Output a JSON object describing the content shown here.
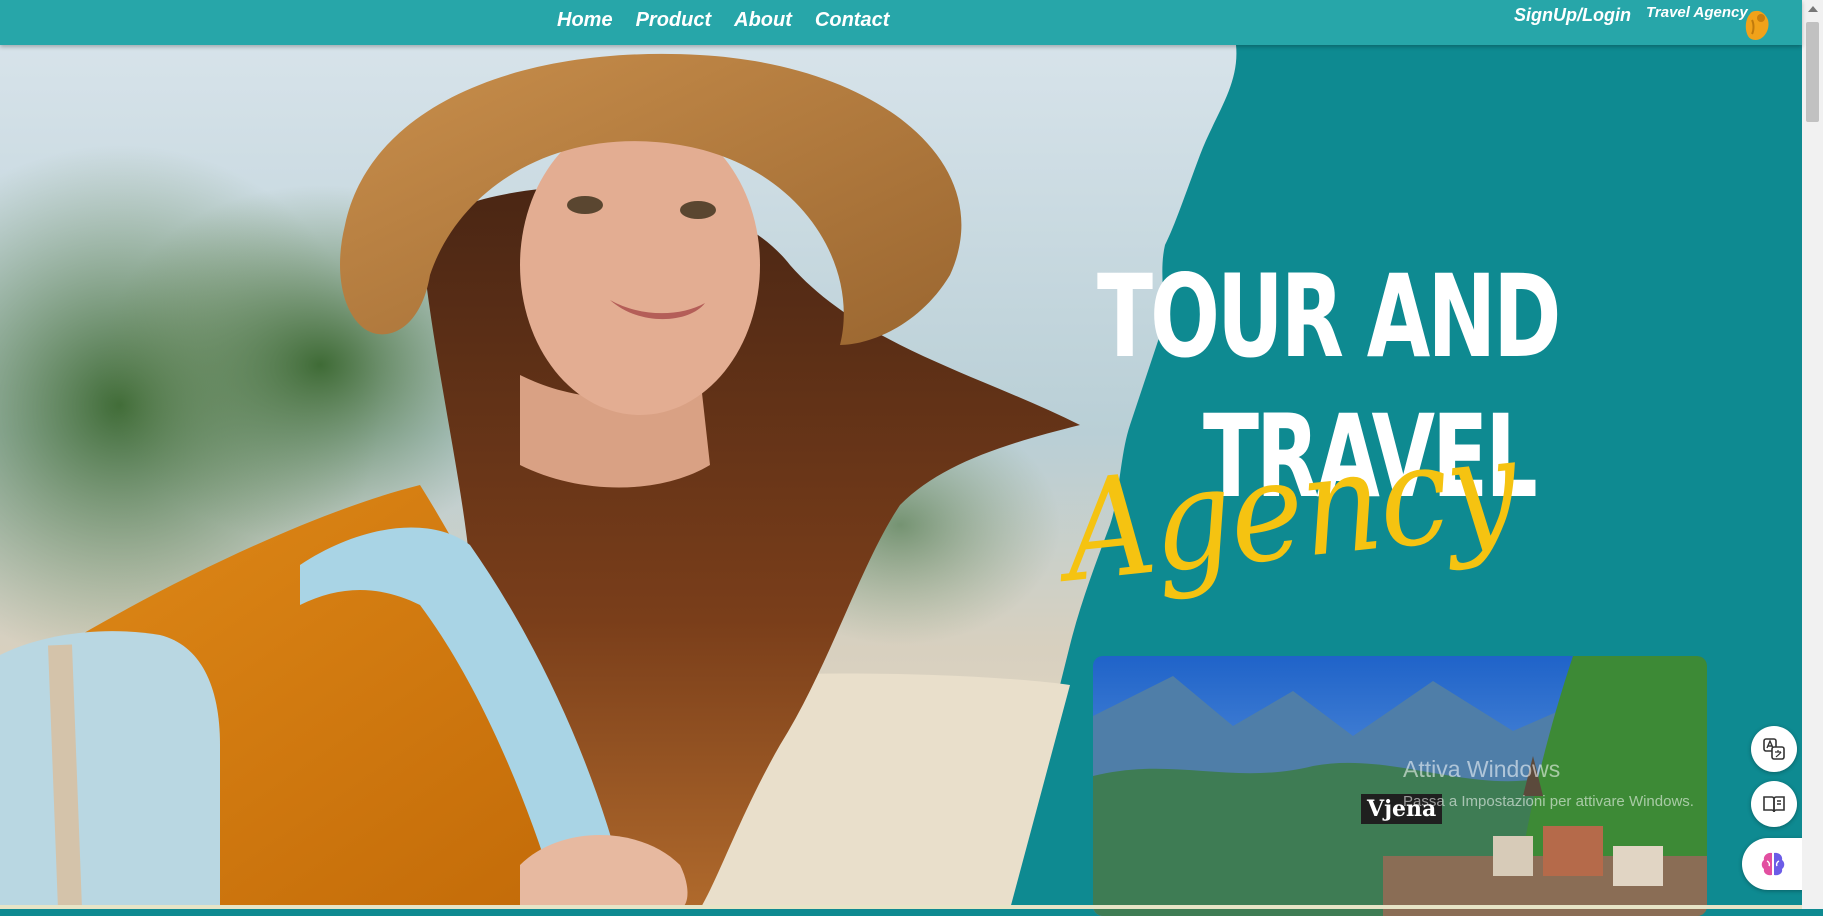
{
  "nav": {
    "links": [
      "Home",
      "Product",
      "About",
      "Contact"
    ],
    "auth": "SignUp/Login",
    "brand": "Travel Agency",
    "brand_icon": "backpack-icon"
  },
  "hero": {
    "title_line1": "TOUR AND",
    "title_line2": "TRAVEL",
    "title_script": "Agency",
    "photo": "smiling-woman-with-hat-and-backpack"
  },
  "destination": {
    "label": "Vjena",
    "photo": "alpine-lake-village"
  },
  "watermark": {
    "title": "Attiva Windows",
    "subtitle": "Passa a Impostazioni per attivare Windows."
  },
  "side_buttons": [
    "translate-icon",
    "reader-icon",
    "brain-icon"
  ],
  "colors": {
    "navbar": "#27a6a9",
    "hero_bg": "#0e8a91",
    "script_accent": "#f5c311",
    "text": "#ffffff"
  }
}
